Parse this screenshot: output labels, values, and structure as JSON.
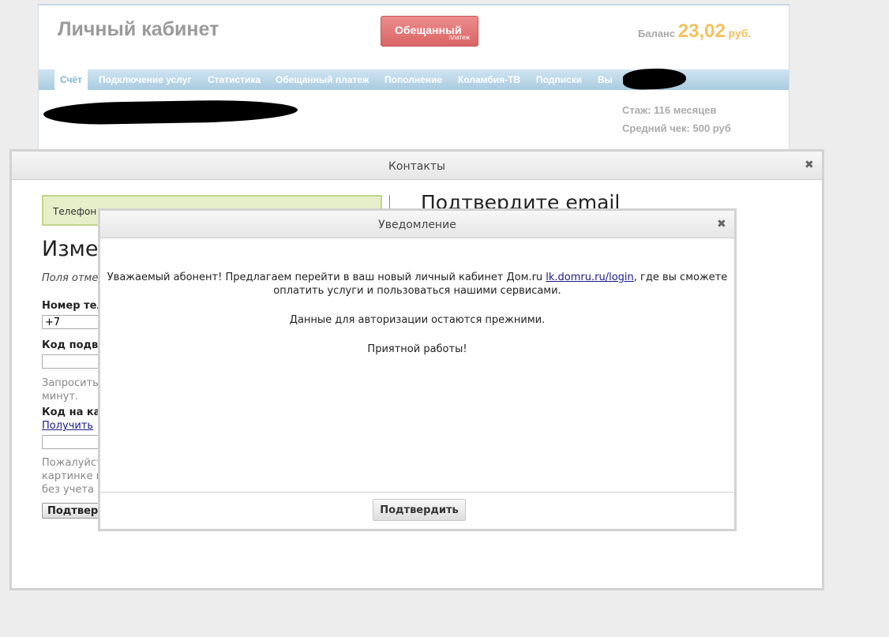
{
  "header": {
    "title": "Личный кабинет",
    "promise_button": {
      "line1": "Обещанный",
      "line2": "платеж"
    },
    "balance": {
      "label": "Баланс",
      "amount": "23,02",
      "currency": "руб."
    }
  },
  "nav": {
    "items": [
      {
        "label": "Счёт",
        "active": true
      },
      {
        "label": "Подключение услуг"
      },
      {
        "label": "Статистика"
      },
      {
        "label": "Обещанный платеж"
      },
      {
        "label": "Пополнение"
      },
      {
        "label": "Коламбия-ТВ"
      },
      {
        "label": "Подписки"
      },
      {
        "label": "Вы"
      }
    ]
  },
  "account": {
    "tenure": "Стаж: 116 месяцев",
    "avg_check": "Средний чек: 500 руб"
  },
  "contacts_dialog": {
    "title": "Контакты",
    "close_glyph": "✖",
    "phone_box_text": "Телефон",
    "confirm_email_heading": "Подтвердите email",
    "change_heading": "Изме",
    "fields_note": "Поля отме",
    "phone_label": "Номер тел",
    "phone_value": "+7",
    "code_label": "Код подве",
    "request_hint": [
      "Запросить",
      "минут."
    ],
    "captcha_label": "Код на кар",
    "get_link": "Получить",
    "captcha_hint": [
      "Пожалуйст",
      "картинке в",
      "без учета"
    ],
    "confirm_button": "Подтверд"
  },
  "notification_dialog": {
    "title": "Уведомление",
    "close_glyph": "✖",
    "message_prefix": "Уважаемый абонент! Предлагаем перейти в ваш новый личный кабинет Дом.ru ",
    "message_link": "lk.domru.ru/login",
    "message_suffix": ", где вы сможете оплатить услуги и пользоваться нашими сервисами.",
    "line2": "Данные для авторизации остаются прежними.",
    "line3": "Приятной работы!",
    "confirm_button": "Подтвердить"
  }
}
